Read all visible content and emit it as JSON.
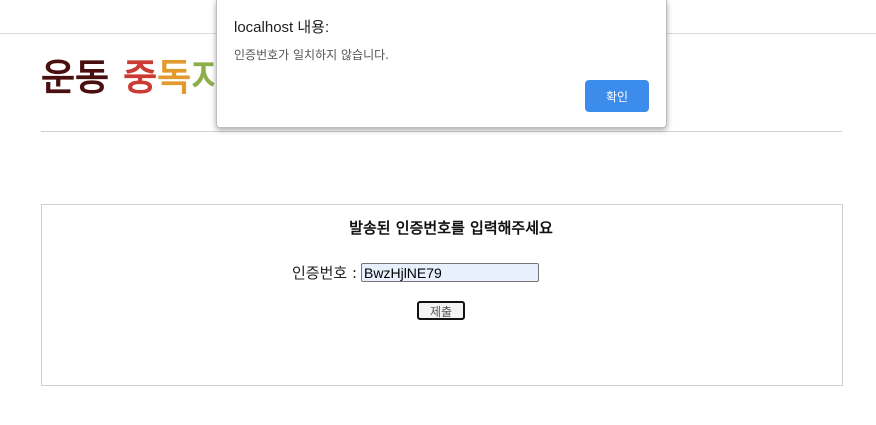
{
  "logo": {
    "parts": [
      {
        "text": "운동",
        "color": "#4a0f0f"
      },
      {
        "text": "중",
        "color": "#cc3b33"
      },
      {
        "text": "독",
        "color": "#e29a2c"
      },
      {
        "text": "지",
        "color": "#8cae49"
      }
    ]
  },
  "verify": {
    "title": "발송된 인증번호를 입력해주세요",
    "code_label": "인증번호 :",
    "code_value": "BwzHjlNE79",
    "submit_label": "제출"
  },
  "alert": {
    "origin": "localhost 내용:",
    "message": "인증번호가 일치하지 않습니다.",
    "ok_label": "확인",
    "ok_color": "#3c8cec"
  }
}
